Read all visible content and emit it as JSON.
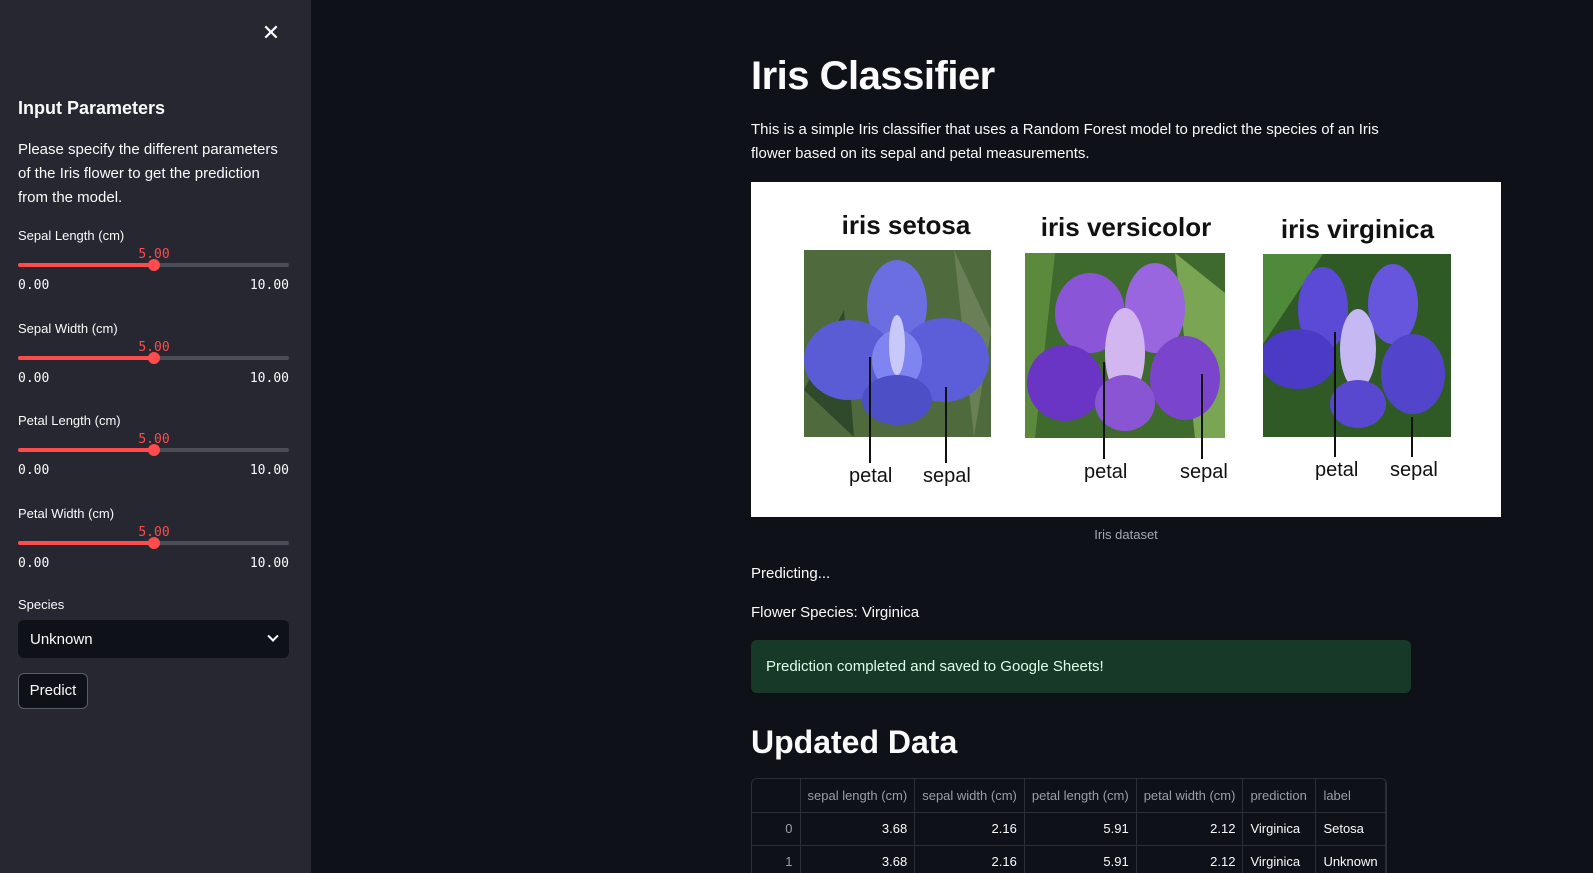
{
  "sidebar": {
    "title": "Input Parameters",
    "description": "Please specify the different parameters of the Iris flower to get the prediction from the model.",
    "sliders": [
      {
        "label": "Sepal Length (cm)",
        "value": "5.00",
        "min": "0.00",
        "max": "10.00",
        "fraction": 0.5
      },
      {
        "label": "Sepal Width (cm)",
        "value": "5.00",
        "min": "0.00",
        "max": "10.00",
        "fraction": 0.5
      },
      {
        "label": "Petal Length (cm)",
        "value": "5.00",
        "min": "0.00",
        "max": "10.00",
        "fraction": 0.5
      },
      {
        "label": "Petal Width (cm)",
        "value": "5.00",
        "min": "0.00",
        "max": "10.00",
        "fraction": 0.5
      }
    ],
    "species_label": "Species",
    "species_value": "Unknown",
    "predict_label": "Predict",
    "close_icon": "close-icon"
  },
  "main": {
    "title": "Iris Classifier",
    "description": "This is a simple Iris classifier that uses a Random Forest model to predict the species of an Iris flower based on its sepal and petal measurements.",
    "image": {
      "panels": [
        {
          "title": "iris setosa",
          "petal": "petal",
          "sepal": "sepal"
        },
        {
          "title": "iris versicolor",
          "petal": "petal",
          "sepal": "sepal"
        },
        {
          "title": "iris virginica",
          "petal": "petal",
          "sepal": "sepal"
        }
      ]
    },
    "caption": "Iris dataset",
    "predicting": "Predicting...",
    "species_result": "Flower Species: Virginica",
    "success_message": "Prediction completed and saved to Google Sheets!",
    "section_title": "Updated Data"
  },
  "table": {
    "columns": [
      "",
      "sepal length (cm)",
      "sepal width (cm)",
      "petal length (cm)",
      "petal width (cm)",
      "prediction",
      "label"
    ],
    "rows": [
      [
        "0",
        "3.68",
        "2.16",
        "5.91",
        "2.12",
        "Virginica",
        "Setosa"
      ],
      [
        "1",
        "3.68",
        "2.16",
        "5.91",
        "2.12",
        "Virginica",
        "Unknown"
      ]
    ]
  },
  "colors": {
    "accent": "#ff4b4b",
    "background": "#0e1117",
    "sidebar": "#262730",
    "success_bg": "#173928"
  }
}
